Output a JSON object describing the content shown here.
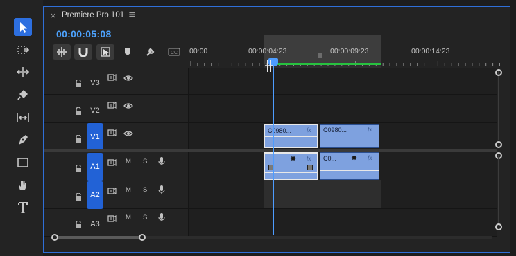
{
  "tools": [
    {
      "name": "selection-tool",
      "active": true
    },
    {
      "name": "track-select-tool",
      "active": false
    },
    {
      "name": "ripple-edit-tool",
      "active": false
    },
    {
      "name": "razor-tool",
      "active": false
    },
    {
      "name": "slip-tool",
      "active": false
    },
    {
      "name": "pen-tool",
      "active": false
    },
    {
      "name": "rectangle-tool",
      "active": false
    },
    {
      "name": "hand-tool",
      "active": false
    },
    {
      "name": "type-tool",
      "active": false
    }
  ],
  "panel": {
    "close_glyph": "×",
    "title": "Premiere Pro 101",
    "menu_glyph": "≡",
    "timecode": "00:00:05:08"
  },
  "ruler": {
    "labels": [
      "00:00",
      "00:00:04:23",
      "00:00:09:23",
      "00:00:14:23"
    ]
  },
  "tracks": [
    {
      "id": "V3",
      "kind": "video",
      "active": false
    },
    {
      "id": "V2",
      "kind": "video",
      "active": false
    },
    {
      "id": "V1",
      "kind": "video",
      "active": true
    },
    {
      "id": "A1",
      "kind": "audio",
      "active": true
    },
    {
      "id": "A2",
      "kind": "audio",
      "active": true
    },
    {
      "id": "A3",
      "kind": "audio",
      "active": false
    }
  ],
  "audio_buttons": {
    "mute": "M",
    "solo": "S"
  },
  "clips": {
    "v1_a": {
      "label": "C0980...",
      "fx": "fx"
    },
    "v1_b": {
      "label": "C0980...",
      "fx": "fx"
    },
    "a1_a": {
      "label": "",
      "fx": "fx"
    },
    "a1_b": {
      "label": "C0...",
      "fx": "fx"
    }
  },
  "colors": {
    "accent": "#2d6fe0",
    "timecode": "#4da3ff",
    "clip": "#7ea1df",
    "workbar_green": "#27c13f"
  }
}
